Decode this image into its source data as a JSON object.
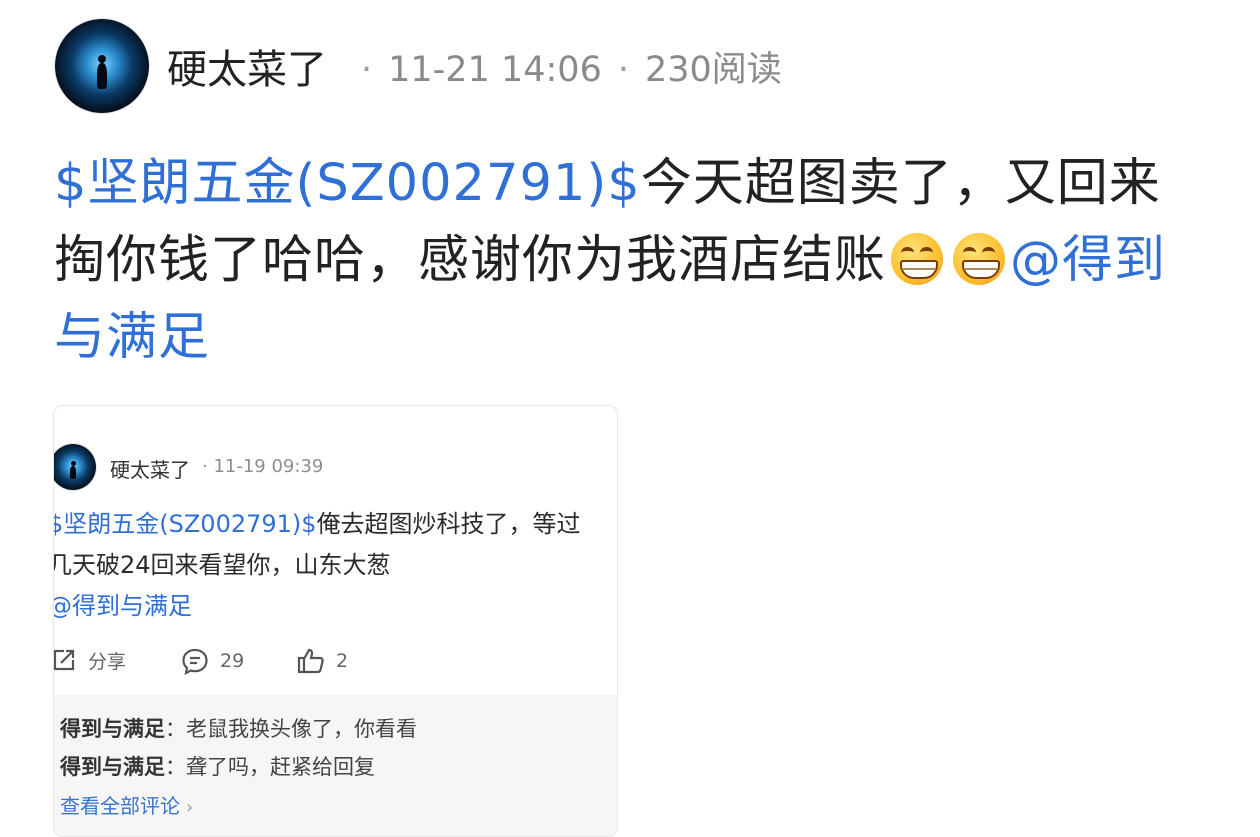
{
  "post": {
    "author": "硬太菜了",
    "date": "11-21 14:06",
    "reads": "230阅读",
    "stock_tag": "$坚朗五金(SZ002791)$",
    "text_part1": "今天超图卖了，又回来掏你钱了哈哈，感谢你为我酒店结账",
    "emoji": [
      "grin-emoji",
      "grin-emoji"
    ],
    "mention": "@得到与满足"
  },
  "quoted": {
    "author": "硬太菜了",
    "date": "11-19 09:39",
    "stock_tag": "$坚朗五金(SZ002791)$",
    "text": "俺去超图炒科技了，等过几天破24回来看望你，山东大葱",
    "mention": "@得到与满足",
    "actions": {
      "share_label": "分享",
      "comment_count": "29",
      "like_count": "2"
    },
    "comments": [
      {
        "user": "得到与满足",
        "text": "：老鼠我换头像了，你看看"
      },
      {
        "user": "得到与满足",
        "text": "：聋了吗，赶紧给回复"
      }
    ],
    "view_all": "查看全部评论"
  },
  "colors": {
    "link": "#2f6fd6",
    "meta": "#8a8a8a",
    "comment_bg": "#f6f6f7"
  }
}
